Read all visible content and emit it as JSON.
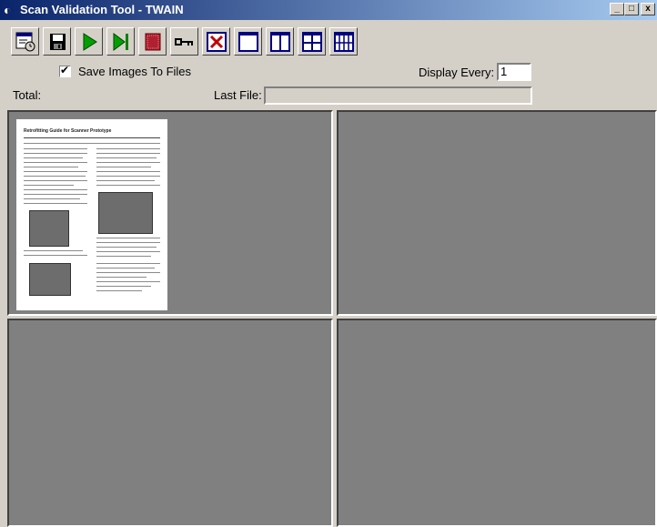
{
  "window": {
    "title": "Scan Validation Tool - TWAIN"
  },
  "window_controls": {
    "minimize": "_",
    "maximize": "□",
    "close": "x"
  },
  "toolbar": {
    "buttons": [
      {
        "name": "setup-icon"
      },
      {
        "name": "save-icon"
      },
      {
        "name": "start-scan-icon"
      },
      {
        "name": "scan-one-icon"
      },
      {
        "name": "stop-icon"
      },
      {
        "name": "key-icon"
      },
      {
        "name": "no-image-icon"
      },
      {
        "name": "one-image-icon"
      },
      {
        "name": "two-images-icon"
      },
      {
        "name": "four-images-icon"
      },
      {
        "name": "eight-images-icon"
      }
    ]
  },
  "options": {
    "save_images_label": "Save Images To Files",
    "save_images_checked": true,
    "display_every_label": "Display Every:",
    "display_every_value": "1"
  },
  "status": {
    "total_label": "Total:",
    "last_file_label": "Last File:",
    "last_file_value": ""
  },
  "thumbnail": {
    "document_title": "Retrofitting Guide for Scanner Prototype"
  }
}
